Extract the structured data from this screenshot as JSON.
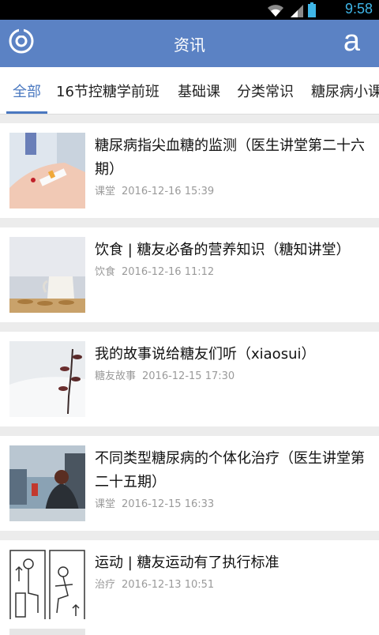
{
  "status_bar": {
    "time": "9:58"
  },
  "header": {
    "title": "资讯",
    "right_action": "a"
  },
  "tabs": [
    {
      "label": "全部",
      "active": true
    },
    {
      "label": "16节控糖学前班"
    },
    {
      "label": "基础课"
    },
    {
      "label": "分类常识"
    },
    {
      "label": "糖尿病小课"
    }
  ],
  "articles": [
    {
      "title": "糖尿病指尖血糖的监测（医生讲堂第二十六期）",
      "category": "课堂",
      "date": "2016-12-16 15:39"
    },
    {
      "title": "饮食 | 糖友必备的营养知识（糖知讲堂）",
      "category": "饮食",
      "date": "2016-12-16 11:12"
    },
    {
      "title": "我的故事说给糖友们听（xiaosui）",
      "category": "糖友故事",
      "date": "2016-12-15 17:30"
    },
    {
      "title": "不同类型糖尿病的个体化治疗（医生讲堂第二十五期）",
      "category": "课堂",
      "date": "2016-12-15 16:33"
    },
    {
      "title": "运动 | 糖友运动有了执行标准",
      "category": "治疗",
      "date": "2016-12-13 10:51"
    }
  ],
  "colors": {
    "header": "#5b82c4",
    "active_tab": "#4a78c0",
    "status_time": "#3fb6e8"
  }
}
